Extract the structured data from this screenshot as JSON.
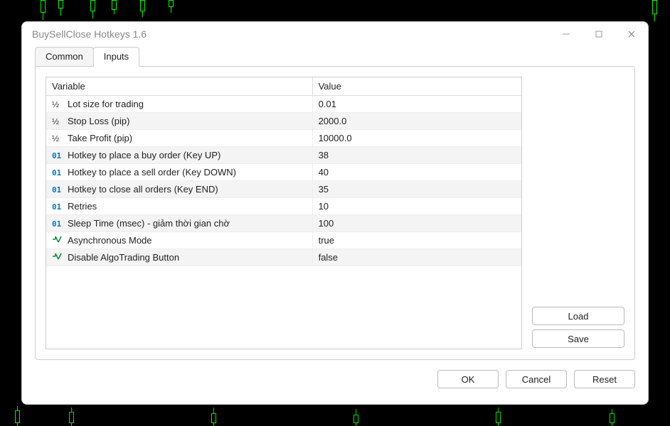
{
  "window": {
    "title": "BuySellClose Hotkeys 1.6"
  },
  "tabs": {
    "common": "Common",
    "inputs": "Inputs",
    "active": "inputs"
  },
  "headers": {
    "variable": "Variable",
    "value": "Value"
  },
  "rows": [
    {
      "icon": "half",
      "label": "Lot size for trading",
      "value": "0.01"
    },
    {
      "icon": "half",
      "label": "Stop Loss (pip)",
      "value": "2000.0"
    },
    {
      "icon": "half",
      "label": "Take Profit (pip)",
      "value": "10000.0"
    },
    {
      "icon": "int",
      "label": "Hotkey to place a buy order (Key UP)",
      "value": "38"
    },
    {
      "icon": "int",
      "label": "Hotkey to place a sell order (Key DOWN)",
      "value": "40"
    },
    {
      "icon": "int",
      "label": "Hotkey to close all orders (Key END)",
      "value": "35"
    },
    {
      "icon": "int",
      "label": "Retries",
      "value": "10"
    },
    {
      "icon": "int",
      "label": "Sleep Time (msec) - giảm thời gian chờ",
      "value": "100"
    },
    {
      "icon": "bool",
      "label": "Asynchronous Mode",
      "value": "true"
    },
    {
      "icon": "bool",
      "label": "Disable AlgoTrading Button",
      "value": "false"
    }
  ],
  "buttons": {
    "load": "Load",
    "save": "Save",
    "ok": "OK",
    "cancel": "Cancel",
    "reset": "Reset"
  }
}
